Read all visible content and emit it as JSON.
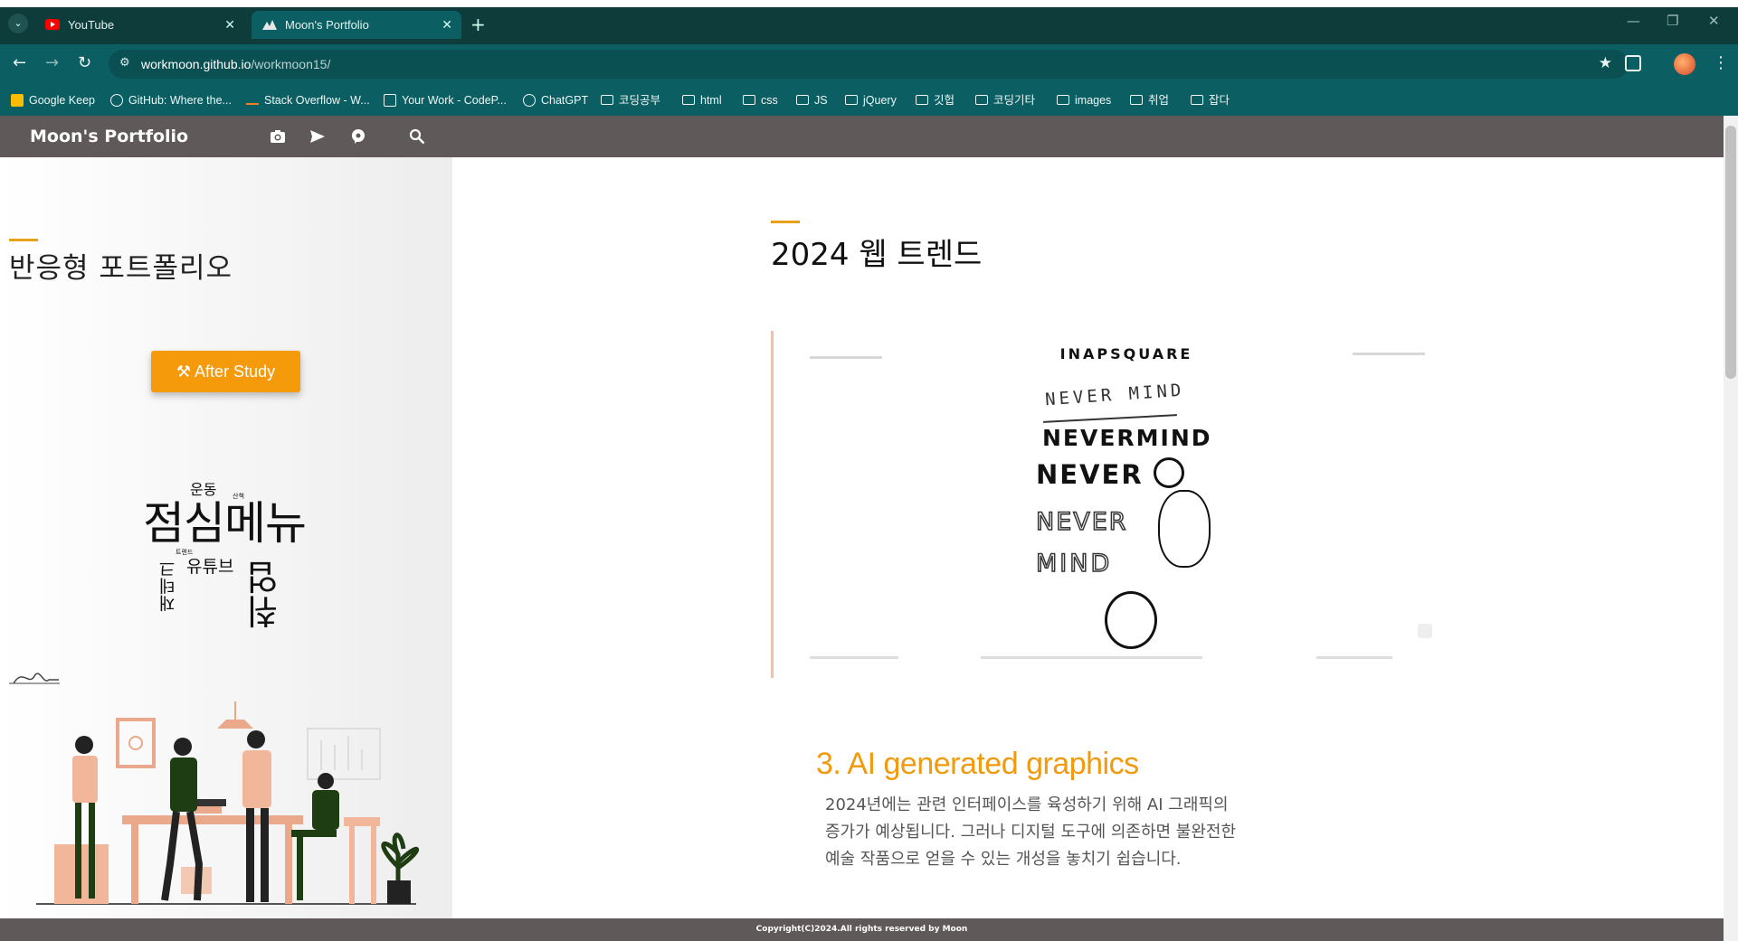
{
  "browser": {
    "tabs": [
      {
        "title": "YouTube",
        "active": false,
        "favicon": "youtube-icon"
      },
      {
        "title": "Moon's Portfolio",
        "active": true,
        "favicon": "mountain-icon"
      }
    ],
    "address": {
      "host": "workmoon.github.io",
      "path": "/workmoon15/"
    },
    "bookmarks": [
      {
        "label": "Google Keep",
        "icon": "keep-icon"
      },
      {
        "label": "GitHub: Where the...",
        "icon": "github-icon"
      },
      {
        "label": "Stack Overflow - W...",
        "icon": "stackoverflow-icon"
      },
      {
        "label": "Your Work - CodeP...",
        "icon": "codepen-icon"
      },
      {
        "label": "ChatGPT",
        "icon": "chatgpt-icon"
      },
      {
        "label": "코딩공부",
        "icon": "folder-icon"
      },
      {
        "label": "html",
        "icon": "folder-icon"
      },
      {
        "label": "css",
        "icon": "folder-icon"
      },
      {
        "label": "JS",
        "icon": "folder-icon"
      },
      {
        "label": "jQuery",
        "icon": "folder-icon"
      },
      {
        "label": "깃헙",
        "icon": "folder-icon"
      },
      {
        "label": "코딩기타",
        "icon": "folder-icon"
      },
      {
        "label": "images",
        "icon": "folder-icon"
      },
      {
        "label": "취업",
        "icon": "folder-icon"
      },
      {
        "label": "잡다",
        "icon": "folder-icon"
      }
    ]
  },
  "site": {
    "title": "Moon's Portfolio",
    "header_icons": [
      "camera-icon",
      "send-icon",
      "chat-icon",
      "search-icon"
    ]
  },
  "sidebar": {
    "heading": "반응형 포트폴리오",
    "button_label": "After Study",
    "word_cloud": [
      "운동",
      "산책",
      "점심메뉴",
      "트렌드",
      "유튜브",
      "재테크",
      "취업"
    ]
  },
  "main": {
    "heading": "2024 웹 트렌드",
    "image_texts": [
      "INAPSQUARE",
      "NEVER MIND",
      "NEVERMIND",
      "NEVER",
      "NEVER",
      "MIND"
    ],
    "section_title": "3. AI generated graphics",
    "section_body": [
      "2024년에는 관련 인터페이스를 육성하기 위해 AI 그래픽의",
      "증가가 예상됩니다. 그러나 디지털 도구에 의존하면 불완전한",
      "예술 작품으로 얻을 수 있는 개성을 놓치기 쉽습니다."
    ]
  },
  "footer": {
    "text": "Copyright(C)2024.All rights reserved by Moon"
  },
  "colors": {
    "accent": "#f29a0d",
    "header_bg": "#5f5959",
    "chrome_bg": "#0b5f63"
  }
}
